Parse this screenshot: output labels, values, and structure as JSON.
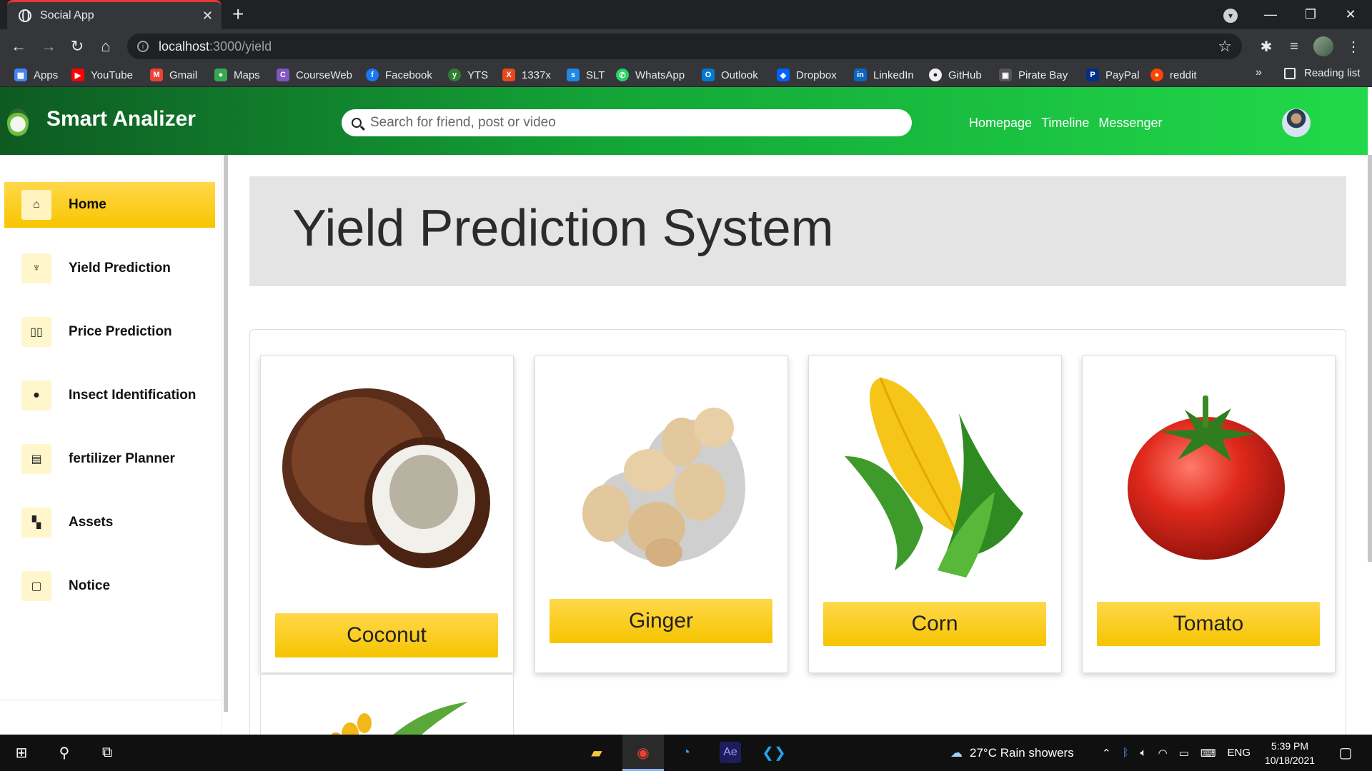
{
  "browser": {
    "tab_title": "Social App",
    "url_host": "localhost",
    "url_path": ":3000/yield",
    "bookmarks": [
      "Apps",
      "YouTube",
      "Gmail",
      "Maps",
      "CourseWeb",
      "Facebook",
      "YTS",
      "1337x",
      "SLT",
      "WhatsApp",
      "Outlook",
      "Dropbox",
      "LinkedIn",
      "GitHub",
      "Pirate Bay",
      "PayPal",
      "reddit"
    ],
    "reading_list": "Reading list"
  },
  "header": {
    "brand": "Smart Analizer",
    "search_placeholder": "Search for friend, post or video",
    "nav": [
      "Homepage",
      "Timeline",
      "Messenger"
    ]
  },
  "sidebar": {
    "items": [
      {
        "label": "Home",
        "icon": "home-icon",
        "active": true
      },
      {
        "label": "Yield Prediction",
        "icon": "sprout-icon",
        "active": false
      },
      {
        "label": "Price Prediction",
        "icon": "book-icon",
        "active": false
      },
      {
        "label": "Insect Identification",
        "icon": "bug-icon",
        "active": false
      },
      {
        "label": "fertilizer Planner",
        "icon": "document-icon",
        "active": false
      },
      {
        "label": "Assets",
        "icon": "boxes-icon",
        "active": false
      },
      {
        "label": "Notice",
        "icon": "page-icon",
        "active": false
      }
    ]
  },
  "main": {
    "title": "Yield Prediction System",
    "crops": [
      "Coconut",
      "Ginger",
      "Corn",
      "Tomato"
    ]
  },
  "taskbar": {
    "weather": "27°C  Rain showers",
    "lang": "ENG",
    "time": "5:39 PM",
    "date": "10/18/2021"
  },
  "colors": {
    "accent_yellow": "#f8c500",
    "header_green_dark": "#0e5a22",
    "header_green_light": "#21d94a"
  }
}
